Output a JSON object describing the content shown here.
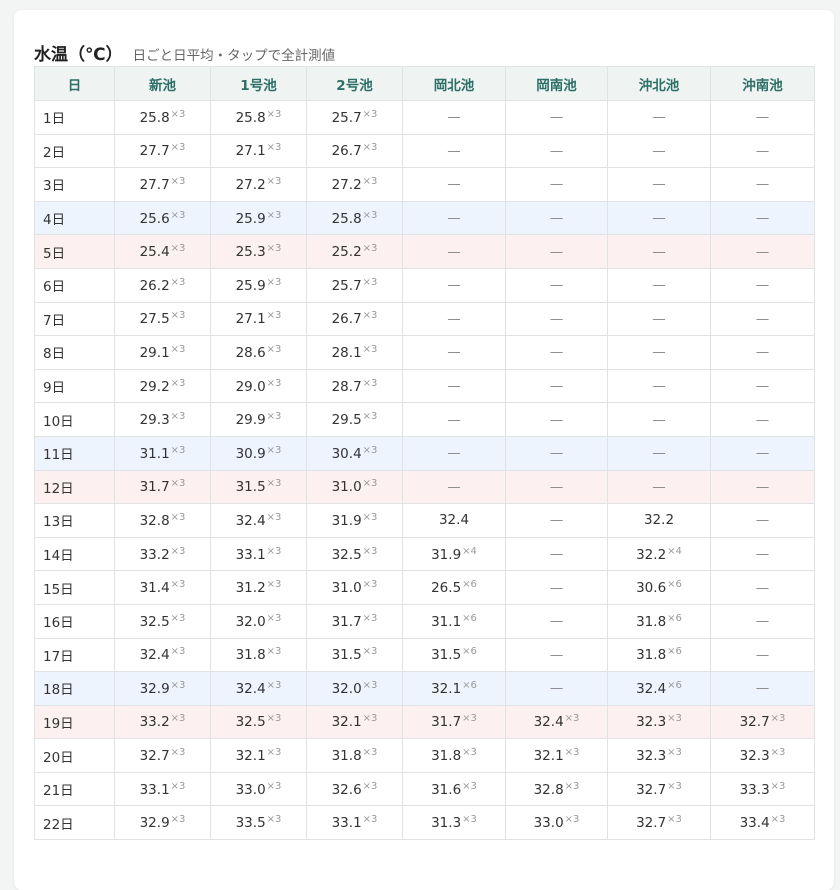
{
  "header": {
    "title": "水温（℃）",
    "subtitle": "日ごと日平均・タップで全計測値"
  },
  "dash": "—",
  "columns": [
    "日",
    "新池",
    "1号池",
    "2号池",
    "岡北池",
    "岡南池",
    "沖北池",
    "沖南池"
  ],
  "rows": [
    {
      "day": "1日",
      "type": "normal",
      "cells": [
        {
          "v": "25.8",
          "n": "×3"
        },
        {
          "v": "25.8",
          "n": "×3"
        },
        {
          "v": "25.7",
          "n": "×3"
        },
        null,
        null,
        null,
        null
      ]
    },
    {
      "day": "2日",
      "type": "normal",
      "cells": [
        {
          "v": "27.7",
          "n": "×3"
        },
        {
          "v": "27.1",
          "n": "×3"
        },
        {
          "v": "26.7",
          "n": "×3"
        },
        null,
        null,
        null,
        null
      ]
    },
    {
      "day": "3日",
      "type": "normal",
      "cells": [
        {
          "v": "27.7",
          "n": "×3"
        },
        {
          "v": "27.2",
          "n": "×3"
        },
        {
          "v": "27.2",
          "n": "×3"
        },
        null,
        null,
        null,
        null
      ]
    },
    {
      "day": "4日",
      "type": "sat",
      "cells": [
        {
          "v": "25.6",
          "n": "×3"
        },
        {
          "v": "25.9",
          "n": "×3"
        },
        {
          "v": "25.8",
          "n": "×3"
        },
        null,
        null,
        null,
        null
      ]
    },
    {
      "day": "5日",
      "type": "sun",
      "cells": [
        {
          "v": "25.4",
          "n": "×3"
        },
        {
          "v": "25.3",
          "n": "×3"
        },
        {
          "v": "25.2",
          "n": "×3"
        },
        null,
        null,
        null,
        null
      ]
    },
    {
      "day": "6日",
      "type": "normal",
      "cells": [
        {
          "v": "26.2",
          "n": "×3"
        },
        {
          "v": "25.9",
          "n": "×3"
        },
        {
          "v": "25.7",
          "n": "×3"
        },
        null,
        null,
        null,
        null
      ]
    },
    {
      "day": "7日",
      "type": "normal",
      "cells": [
        {
          "v": "27.5",
          "n": "×3"
        },
        {
          "v": "27.1",
          "n": "×3"
        },
        {
          "v": "26.7",
          "n": "×3"
        },
        null,
        null,
        null,
        null
      ]
    },
    {
      "day": "8日",
      "type": "normal",
      "cells": [
        {
          "v": "29.1",
          "n": "×3"
        },
        {
          "v": "28.6",
          "n": "×3"
        },
        {
          "v": "28.1",
          "n": "×3"
        },
        null,
        null,
        null,
        null
      ]
    },
    {
      "day": "9日",
      "type": "normal",
      "cells": [
        {
          "v": "29.2",
          "n": "×3"
        },
        {
          "v": "29.0",
          "n": "×3"
        },
        {
          "v": "28.7",
          "n": "×3"
        },
        null,
        null,
        null,
        null
      ]
    },
    {
      "day": "10日",
      "type": "normal",
      "cells": [
        {
          "v": "29.3",
          "n": "×3"
        },
        {
          "v": "29.9",
          "n": "×3"
        },
        {
          "v": "29.5",
          "n": "×3"
        },
        null,
        null,
        null,
        null
      ]
    },
    {
      "day": "11日",
      "type": "sat",
      "cells": [
        {
          "v": "31.1",
          "n": "×3"
        },
        {
          "v": "30.9",
          "n": "×3"
        },
        {
          "v": "30.4",
          "n": "×3"
        },
        null,
        null,
        null,
        null
      ]
    },
    {
      "day": "12日",
      "type": "sun",
      "cells": [
        {
          "v": "31.7",
          "n": "×3"
        },
        {
          "v": "31.5",
          "n": "×3"
        },
        {
          "v": "31.0",
          "n": "×3"
        },
        null,
        null,
        null,
        null
      ]
    },
    {
      "day": "13日",
      "type": "normal",
      "cells": [
        {
          "v": "32.8",
          "n": "×3"
        },
        {
          "v": "32.4",
          "n": "×3"
        },
        {
          "v": "31.9",
          "n": "×3"
        },
        {
          "v": "32.4",
          "n": ""
        },
        null,
        {
          "v": "32.2",
          "n": ""
        },
        null
      ]
    },
    {
      "day": "14日",
      "type": "normal",
      "cells": [
        {
          "v": "33.2",
          "n": "×3"
        },
        {
          "v": "33.1",
          "n": "×3"
        },
        {
          "v": "32.5",
          "n": "×3"
        },
        {
          "v": "31.9",
          "n": "×4"
        },
        null,
        {
          "v": "32.2",
          "n": "×4"
        },
        null
      ]
    },
    {
      "day": "15日",
      "type": "normal",
      "cells": [
        {
          "v": "31.4",
          "n": "×3"
        },
        {
          "v": "31.2",
          "n": "×3"
        },
        {
          "v": "31.0",
          "n": "×3"
        },
        {
          "v": "26.5",
          "n": "×6"
        },
        null,
        {
          "v": "30.6",
          "n": "×6"
        },
        null
      ]
    },
    {
      "day": "16日",
      "type": "normal",
      "cells": [
        {
          "v": "32.5",
          "n": "×3"
        },
        {
          "v": "32.0",
          "n": "×3"
        },
        {
          "v": "31.7",
          "n": "×3"
        },
        {
          "v": "31.1",
          "n": "×6"
        },
        null,
        {
          "v": "31.8",
          "n": "×6"
        },
        null
      ]
    },
    {
      "day": "17日",
      "type": "normal",
      "cells": [
        {
          "v": "32.4",
          "n": "×3"
        },
        {
          "v": "31.8",
          "n": "×3"
        },
        {
          "v": "31.5",
          "n": "×3"
        },
        {
          "v": "31.5",
          "n": "×6"
        },
        null,
        {
          "v": "31.8",
          "n": "×6"
        },
        null
      ]
    },
    {
      "day": "18日",
      "type": "sat",
      "cells": [
        {
          "v": "32.9",
          "n": "×3"
        },
        {
          "v": "32.4",
          "n": "×3"
        },
        {
          "v": "32.0",
          "n": "×3"
        },
        {
          "v": "32.1",
          "n": "×6"
        },
        null,
        {
          "v": "32.4",
          "n": "×6"
        },
        null
      ]
    },
    {
      "day": "19日",
      "type": "sun",
      "cells": [
        {
          "v": "33.2",
          "n": "×3"
        },
        {
          "v": "32.5",
          "n": "×3"
        },
        {
          "v": "32.1",
          "n": "×3"
        },
        {
          "v": "31.7",
          "n": "×3"
        },
        {
          "v": "32.4",
          "n": "×3"
        },
        {
          "v": "32.3",
          "n": "×3"
        },
        {
          "v": "32.7",
          "n": "×3"
        }
      ]
    },
    {
      "day": "20日",
      "type": "normal",
      "cells": [
        {
          "v": "32.7",
          "n": "×3"
        },
        {
          "v": "32.1",
          "n": "×3"
        },
        {
          "v": "31.8",
          "n": "×3"
        },
        {
          "v": "31.8",
          "n": "×3"
        },
        {
          "v": "32.1",
          "n": "×3"
        },
        {
          "v": "32.3",
          "n": "×3"
        },
        {
          "v": "32.3",
          "n": "×3"
        }
      ]
    },
    {
      "day": "21日",
      "type": "normal",
      "cells": [
        {
          "v": "33.1",
          "n": "×3"
        },
        {
          "v": "33.0",
          "n": "×3"
        },
        {
          "v": "32.6",
          "n": "×3"
        },
        {
          "v": "31.6",
          "n": "×3"
        },
        {
          "v": "32.8",
          "n": "×3"
        },
        {
          "v": "32.7",
          "n": "×3"
        },
        {
          "v": "33.3",
          "n": "×3"
        }
      ]
    },
    {
      "day": "22日",
      "type": "normal",
      "cells": [
        {
          "v": "32.9",
          "n": "×3"
        },
        {
          "v": "33.5",
          "n": "×3"
        },
        {
          "v": "33.1",
          "n": "×3"
        },
        {
          "v": "31.3",
          "n": "×3"
        },
        {
          "v": "33.0",
          "n": "×3"
        },
        {
          "v": "32.7",
          "n": "×3"
        },
        {
          "v": "33.4",
          "n": "×3"
        }
      ]
    }
  ]
}
